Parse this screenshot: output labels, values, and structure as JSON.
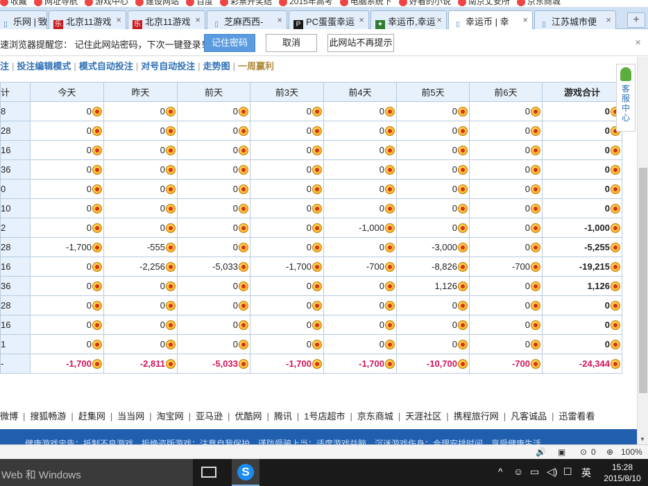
{
  "bookmarks": [
    "收藏",
    "网址导航",
    "游戏中心",
    "建设网站",
    "百度",
    "彩票开奖结",
    "2015年高考",
    "电脑系统下",
    "好看的小说",
    "南京丈安所",
    "京东商城"
  ],
  "tabs": [
    {
      "label": "乐网 | 致",
      "icon": "page",
      "active": false
    },
    {
      "label": "北京11游戏",
      "icon": "le",
      "active": false
    },
    {
      "label": "北京11游戏",
      "icon": "le",
      "active": false
    },
    {
      "label": "芝麻西西-",
      "icon": "page",
      "active": false
    },
    {
      "label": "PC蛋蛋幸运",
      "icon": "pc",
      "active": false
    },
    {
      "label": "幸运币,幸运",
      "icon": "game",
      "active": false
    },
    {
      "label": "幸运币 | 幸",
      "icon": "page",
      "active": true
    },
    {
      "label": "江苏城市便",
      "icon": "page",
      "active": false
    }
  ],
  "new_tab": "+",
  "password_bar": {
    "message": "速浏览器提醒您： 记住此网站密码，下次一键登录！",
    "remember": "记住密码",
    "cancel": "取消",
    "never": "此网站不再提示",
    "close": "×"
  },
  "subnav": {
    "items": [
      "注",
      "投注编辑模式",
      "模式自动投注",
      "对号自动投注",
      "走势图",
      "一周赢利"
    ],
    "separator": "|"
  },
  "stats_table": {
    "headers": [
      "计",
      "今天",
      "昨天",
      "前天",
      "前3天",
      "前4天",
      "前5天",
      "前6天",
      "游戏合计"
    ],
    "rows": [
      {
        "label": "8",
        "values": [
          "0",
          "0",
          "0",
          "0",
          "0",
          "0",
          "0",
          "0"
        ]
      },
      {
        "label": "28",
        "values": [
          "0",
          "0",
          "0",
          "0",
          "0",
          "0",
          "0",
          "0"
        ]
      },
      {
        "label": "16",
        "values": [
          "0",
          "0",
          "0",
          "0",
          "0",
          "0",
          "0",
          "0"
        ]
      },
      {
        "label": "36",
        "values": [
          "0",
          "0",
          "0",
          "0",
          "0",
          "0",
          "0",
          "0"
        ]
      },
      {
        "label": "0",
        "values": [
          "0",
          "0",
          "0",
          "0",
          "0",
          "0",
          "0",
          "0"
        ]
      },
      {
        "label": "10",
        "values": [
          "0",
          "0",
          "0",
          "0",
          "0",
          "0",
          "0",
          "0"
        ]
      },
      {
        "label": "2",
        "values": [
          "0",
          "0",
          "0",
          "0",
          "-1,000",
          "0",
          "0",
          "-1,000"
        ]
      },
      {
        "label": "28",
        "values": [
          "-1,700",
          "-555",
          "0",
          "0",
          "0",
          "-3,000",
          "0",
          "-5,255"
        ]
      },
      {
        "label": "16",
        "values": [
          "0",
          "-2,256",
          "-5,033",
          "-1,700",
          "-700",
          "-8,826",
          "-700",
          "-19,215"
        ]
      },
      {
        "label": "36",
        "values": [
          "0",
          "0",
          "0",
          "0",
          "0",
          "1,126",
          "0",
          "1,126"
        ]
      },
      {
        "label": "28",
        "values": [
          "0",
          "0",
          "0",
          "0",
          "0",
          "0",
          "0",
          "0"
        ]
      },
      {
        "label": "16",
        "values": [
          "0",
          "0",
          "0",
          "0",
          "0",
          "0",
          "0",
          "0"
        ]
      },
      {
        "label": "1",
        "values": [
          "0",
          "0",
          "0",
          "0",
          "0",
          "0",
          "0",
          "0"
        ]
      }
    ],
    "sum_row": {
      "label": "-",
      "values": [
        "-1,700",
        "-2,811",
        "-5,033",
        "-1,700",
        "-1,700",
        "-10,700",
        "-700",
        "-24,344"
      ]
    }
  },
  "links": [
    "微博",
    "搜狐畅游",
    "赶集网",
    "当当网",
    "淘宝网",
    "亚马逊",
    "优酷网",
    "腾讯",
    "1号店超市",
    "京东商城",
    "天涯社区",
    "携程旅行网",
    "凡客诚品",
    "迅雷看看"
  ],
  "footer_text": "健康游戏忠告：抵制不良游戏，拒绝盗版游戏；注意自我保护，谨防受骗上当；适度游戏益脑，沉迷游戏伤身；合理安排时间，享受健康生活。",
  "service": [
    "客",
    "服",
    "中",
    "心"
  ],
  "status_bar": {
    "count": "0",
    "zoom": "100%"
  },
  "taskbar": {
    "search_text": "Web 和 Windows",
    "ime": "英",
    "time": "15:28",
    "date": "2015/8/10"
  }
}
